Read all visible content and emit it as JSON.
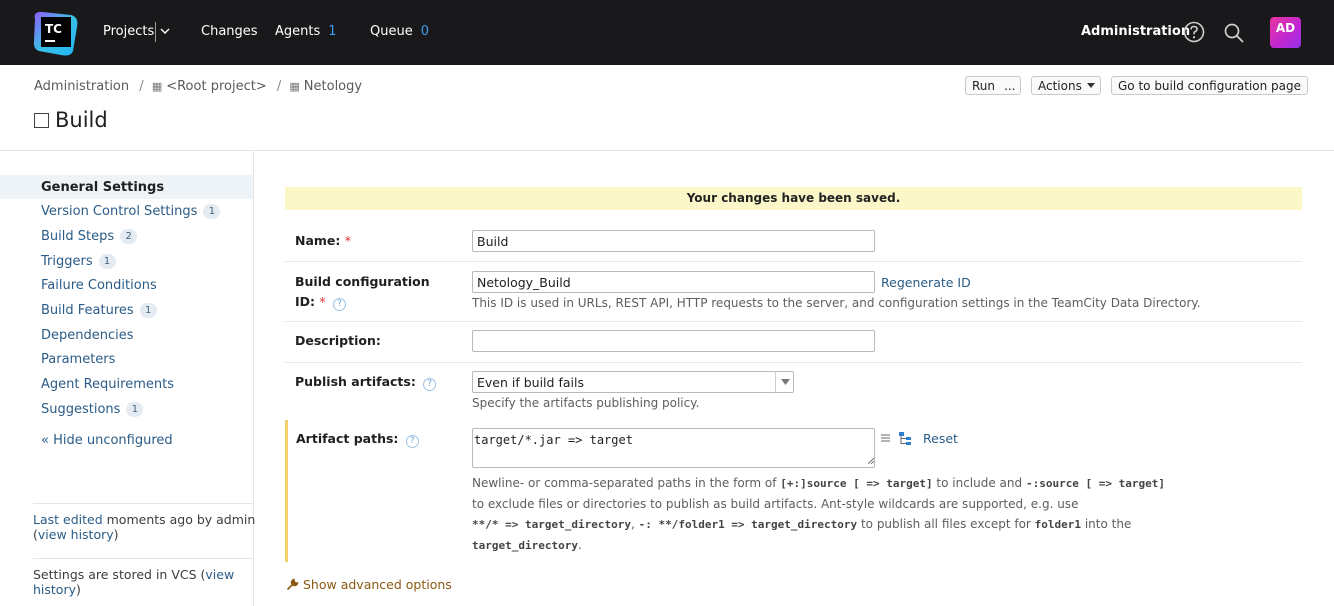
{
  "topbar": {
    "logo_text": "TC",
    "projects_label": "Projects",
    "changes_label": "Changes",
    "agents_label": "Agents",
    "agents_count": "1",
    "queue_label": "Queue",
    "queue_count": "0",
    "administration_label": "Administration",
    "avatar_initials": "AD"
  },
  "breadcrumb": {
    "items": [
      "Administration",
      "<Root project>",
      "Netology"
    ],
    "separator": "/"
  },
  "page": {
    "title": "Build"
  },
  "actions": {
    "run_label": "Run",
    "run_more_label": "...",
    "actions_label": "Actions",
    "goto_label": "Go to build configuration page"
  },
  "sidebar": {
    "items": [
      {
        "label": "General Settings",
        "count": ""
      },
      {
        "label": "Version Control Settings",
        "count": "1"
      },
      {
        "label": "Build Steps",
        "count": "2"
      },
      {
        "label": "Triggers",
        "count": "1"
      },
      {
        "label": "Failure Conditions",
        "count": ""
      },
      {
        "label": "Build Features",
        "count": "1"
      },
      {
        "label": "Dependencies",
        "count": ""
      },
      {
        "label": "Parameters",
        "count": ""
      },
      {
        "label": "Agent Requirements",
        "count": ""
      },
      {
        "label": "Suggestions",
        "count": "1"
      }
    ],
    "hide_unconfigured": "« Hide unconfigured",
    "last_edited_link": "Last edited",
    "last_edited_text": "moments ago by admin",
    "view_history_prefix": "(",
    "view_history": "view history",
    "view_history_suffix": ")",
    "vcs_text": "Settings are stored in VCS (",
    "vcs_view": "view",
    "vcs_history": "history",
    "vcs_suffix": ")"
  },
  "form": {
    "banner": "Your changes have been saved.",
    "name_label": "Name:",
    "name_value": "Build",
    "config_id_label_1": "Build configuration",
    "config_id_label_2": "ID:",
    "config_id_value": "Netology_Build",
    "regenerate_id": "Regenerate ID",
    "config_id_hint": "This ID is used in URLs, REST API, HTTP requests to the server, and configuration settings in the TeamCity Data Directory.",
    "description_label": "Description:",
    "description_value": "",
    "publish_label": "Publish artifacts:",
    "publish_value": "Even if build fails",
    "publish_hint": "Specify the artifacts publishing policy.",
    "artifact_label": "Artifact paths:",
    "artifact_value": "target/*.jar => target",
    "reset_label": "Reset",
    "artifact_help": {
      "l1a": "Newline- or comma-separated paths in the form of ",
      "l1b": "[+:]source [ => target]",
      "l1c": " to include and ",
      "l1d": "-:source [ => target]",
      "l2": "to exclude files or directories to publish as build artifacts. Ant-style wildcards are supported, e.g. use",
      "l3a": "**/* => target_directory",
      "l3b": ", ",
      "l3c": "-: **/folder1 => target_directory",
      "l3d": " to publish all files except for ",
      "l3e": "folder1",
      "l3f": " into the",
      "l4a": "target_directory",
      "l4b": "."
    },
    "advanced_label": "Show advanced options"
  },
  "colors": {
    "topbar_bg": "#19191c",
    "link": "#2b5c87",
    "count_accent": "#3d9df2",
    "banner_bg": "#fbf7c9",
    "required": "#dd3333",
    "highlight_bar": "#f3d06b"
  }
}
